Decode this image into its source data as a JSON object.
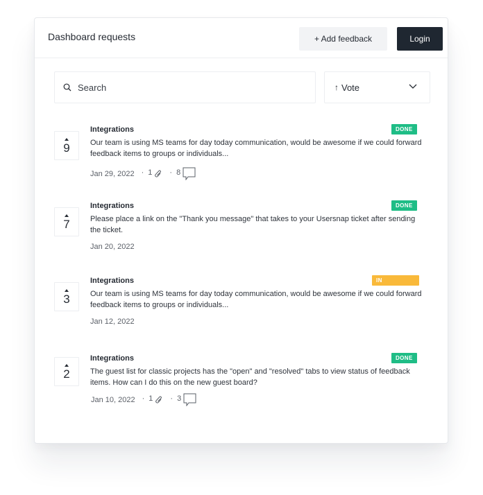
{
  "header": {
    "title": "Dashboard requests",
    "add_feedback_label": "+ Add feedback",
    "login_label": "Login"
  },
  "search": {
    "placeholder": "Search",
    "value": ""
  },
  "sort": {
    "label": "Vote",
    "direction_icon": "arrow-up-icon",
    "dropdown_icon": "chevron-down-icon"
  },
  "colors": {
    "done": "#1fbd86",
    "in_progress": "#f9b93a",
    "login_bg": "#1f2731"
  },
  "items": [
    {
      "votes": "9",
      "category": "Integrations",
      "status": "DONE",
      "description": "Our team is using MS teams for day today communication, would be awesome if we could forward feedback items to groups or individuals...",
      "date": "Jan 29, 2022",
      "attachments": "1",
      "comments": "8"
    },
    {
      "votes": "7",
      "category": "Integrations",
      "status": "DONE",
      "description": "Please place a link on the \"Thank you message\" that takes to your Usersnap ticket after sending the ticket.",
      "date": "Jan 20, 2022"
    },
    {
      "votes": "3",
      "category": "Integrations",
      "status": "IN PROGRESS",
      "description": "Our team is using MS teams for day today communication, would be awesome if we could forward feedback items to groups or individuals...",
      "date": "Jan 12, 2022"
    },
    {
      "votes": "2",
      "category": "Integrations",
      "status": "DONE",
      "description": "The guest list for classic projects has the \"open\" and \"resolved\" tabs to view status of feedback items. How can I do this on the new guest board?",
      "date": "Jan 10, 2022",
      "attachments": "1",
      "comments": "3"
    }
  ]
}
